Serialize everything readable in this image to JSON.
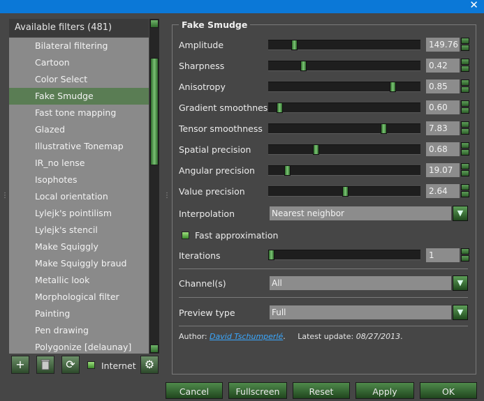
{
  "window": {
    "close_glyph": "✕"
  },
  "filters_panel": {
    "header": "Available filters (481)",
    "items": [
      "Bilateral filtering",
      "Cartoon",
      "Color Select",
      "Fake Smudge",
      "Fast tone mapping",
      "Glazed",
      "Illustrative Tonemap",
      "IR_no lense",
      "Isophotes",
      "Local orientation",
      "Lylejk's pointilism",
      "Lylejk's stencil",
      "Make Squiggly",
      "Make Squiggly braud",
      "Metallic look",
      "Morphological filter",
      "Painting",
      "Pen drawing",
      "Polygonize [delaunay]"
    ],
    "selected_index": 3
  },
  "toolbar": {
    "add_icon": "+",
    "refresh_icon": "⟳",
    "internet_label": "Internet",
    "settings_icon": "⚙"
  },
  "filter": {
    "title": "Fake Smudge",
    "params": [
      {
        "label": "Amplitude",
        "value": "149.76",
        "fraction": 0.16
      },
      {
        "label": "Sharpness",
        "value": "0.42",
        "fraction": 0.22
      },
      {
        "label": "Anisotropy",
        "value": "0.85",
        "fraction": 0.84
      },
      {
        "label": "Gradient smoothness",
        "value": "0.60",
        "fraction": 0.06
      },
      {
        "label": "Tensor smoothness",
        "value": "7.83",
        "fraction": 0.78
      },
      {
        "label": "Spatial precision",
        "value": "0.68",
        "fraction": 0.31
      },
      {
        "label": "Angular precision",
        "value": "19.07",
        "fraction": 0.11
      },
      {
        "label": "Value precision",
        "value": "2.64",
        "fraction": 0.51
      }
    ],
    "interpolation": {
      "label": "Interpolation",
      "value": "Nearest neighbor"
    },
    "fast_approx": {
      "label": "Fast approximation",
      "checked": true
    },
    "iterations": {
      "label": "Iterations",
      "value": "1",
      "fraction": 0.0
    },
    "channels": {
      "label": "Channel(s)",
      "value": "All"
    },
    "preview": {
      "label": "Preview type",
      "value": "Full"
    },
    "author_prefix": "Author:",
    "author_name": "David Tschumperlé",
    "update_prefix": "Latest update:",
    "update_date": "08/27/2013"
  },
  "buttons": {
    "cancel": "Cancel",
    "fullscreen": "Fullscreen",
    "reset": "Reset",
    "apply": "Apply",
    "ok": "OK"
  }
}
